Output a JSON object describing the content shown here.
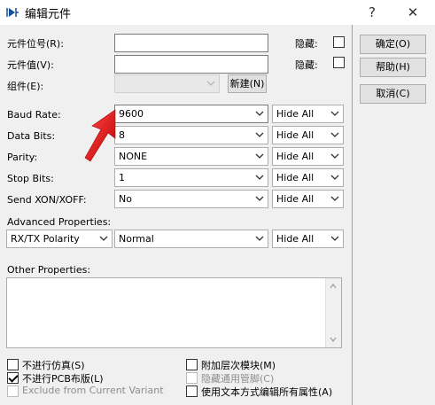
{
  "window": {
    "title": "编辑元件",
    "help_glyph": "?",
    "close_glyph": "✕"
  },
  "fields": {
    "designator_label": "元件位号(R):",
    "designator_value": "",
    "hidden_label_1": "隐藏:",
    "value_label": "元件值(V):",
    "value_value": "",
    "hidden_label_2": "隐藏:",
    "group_label": "组件(E):",
    "group_value": "",
    "new_button": "新建(N)"
  },
  "properties": [
    {
      "label": "Baud Rate:",
      "value": "9600",
      "visibility": "Hide All"
    },
    {
      "label": "Data Bits:",
      "value": "8",
      "visibility": "Hide All"
    },
    {
      "label": "Parity:",
      "value": "NONE",
      "visibility": "Hide All"
    },
    {
      "label": "Stop Bits:",
      "value": "1",
      "visibility": "Hide All"
    },
    {
      "label": "Send XON/XOFF:",
      "value": "No",
      "visibility": "Hide All"
    }
  ],
  "advanced": {
    "label": "Advanced Properties:",
    "property": "RX/TX Polarity",
    "value": "Normal",
    "visibility": "Hide All"
  },
  "other": {
    "label": "Other Properties:",
    "text": ""
  },
  "options": [
    {
      "label": "不进行仿真(S)",
      "checked": false,
      "disabled": false
    },
    {
      "label": "不进行PCB布版(L)",
      "checked": true,
      "disabled": false
    },
    {
      "label": "Exclude from Current Variant",
      "checked": false,
      "disabled": true
    },
    {
      "label": "附加层次模块(M)",
      "checked": false,
      "disabled": false
    },
    {
      "label": "隐藏通用管脚(C)",
      "checked": false,
      "disabled": true
    },
    {
      "label": "使用文本方式编辑所有属性(A)",
      "checked": false,
      "disabled": false
    }
  ],
  "buttons": {
    "ok": "确定(O)",
    "help": "帮助(H)",
    "cancel": "取消(C)"
  },
  "colors": {
    "annotation_arrow": "#e01010"
  }
}
